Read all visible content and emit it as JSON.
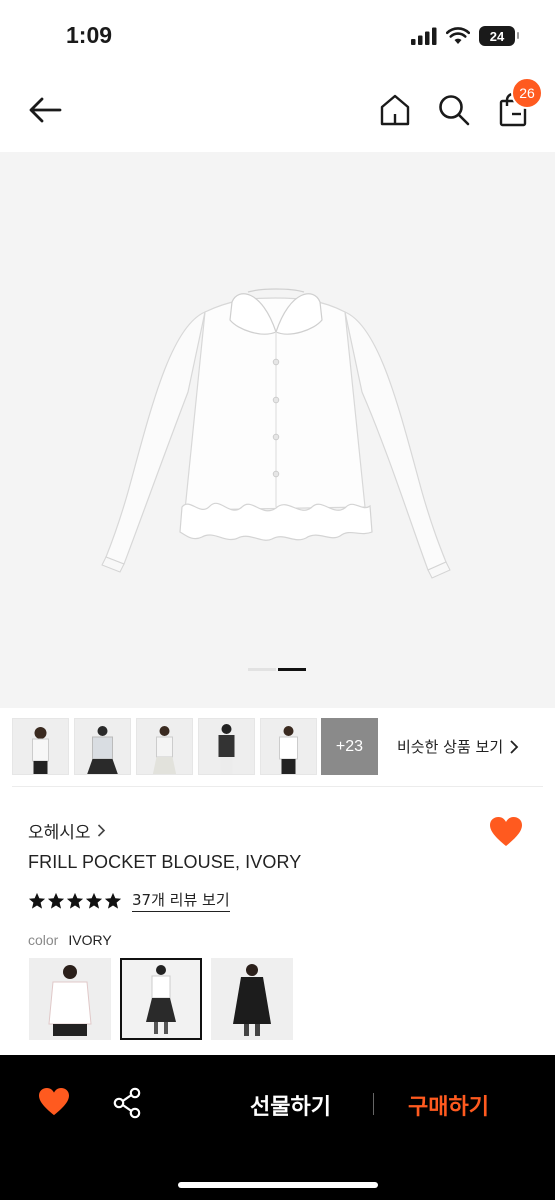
{
  "status_bar": {
    "time": "1:09",
    "battery": "24"
  },
  "nav": {
    "back_icon": "arrow-left-icon",
    "home_icon": "home-icon",
    "search_icon": "search-icon",
    "cart_icon": "shopping-bag-icon",
    "cart_count": "26"
  },
  "hero": {
    "image": "white long-sleeve blouse with frill hem on light grey background",
    "page_count": 2,
    "active_page": 2
  },
  "gallery": {
    "more_label": "+23",
    "similar_label": "비슷한 상품 보기",
    "similar_icon": "chevron-right-icon"
  },
  "product": {
    "brand": "오헤시오",
    "brand_icon": "chevron-right-icon",
    "title": "FRILL POCKET BLOUSE, IVORY",
    "rating": 5,
    "review_link": "37개 리뷰 보기",
    "color_label": "color",
    "color_value": "IVORY",
    "swatch_selected": 2
  },
  "bottom_bar": {
    "gift_label": "선물하기",
    "buy_label": "구매하기"
  },
  "colors": {
    "accent": "#ff5a1f",
    "bottom_bar_bg": "#000000",
    "hero_bg": "#f4f4f4"
  }
}
